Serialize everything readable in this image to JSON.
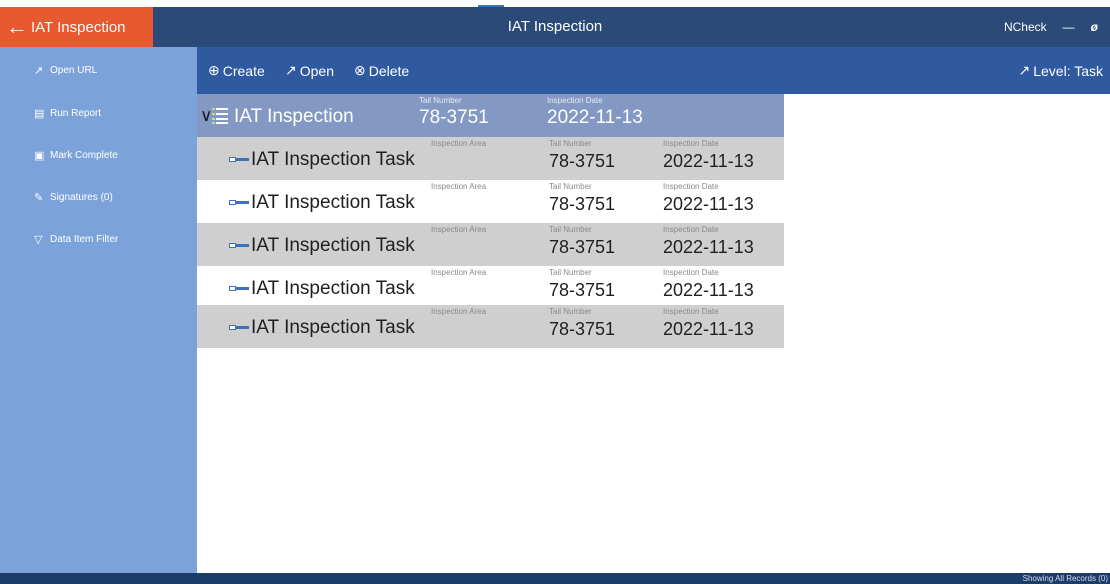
{
  "app": {
    "back_label": "IAT Inspection",
    "window_title": "IAT Inspection",
    "user": "NCheck",
    "minimize_glyph": "—",
    "restore_glyph": "ø"
  },
  "sidebar": {
    "items": [
      {
        "label": "Open URL",
        "icon": "external-link-icon"
      },
      {
        "label": "Run Report",
        "icon": "report-icon"
      },
      {
        "label": "Mark Complete",
        "icon": "lock-icon"
      },
      {
        "label": "Signatures (0)",
        "icon": "signature-icon"
      },
      {
        "label": "Data Item Filter",
        "icon": "filter-icon"
      }
    ]
  },
  "toolbar": {
    "create_label": "Create",
    "open_label": "Open",
    "delete_label": "Delete",
    "level_label": "Level: Task"
  },
  "tree": {
    "parent": {
      "name": "IAT Inspection",
      "tail_label": "Tail Number",
      "tail_value": "78-3751",
      "date_label": "Inspection Date",
      "date_value": "2022-11-13"
    },
    "tasks": [
      {
        "name": "IAT Inspection Task",
        "area_label": "Inspection Area",
        "tail_label": "Tail Number",
        "tail_value": "78-3751",
        "date_label": "Inspection Date",
        "date_value": "2022-11-13"
      },
      {
        "name": "IAT Inspection Task",
        "area_label": "Inspection Area",
        "tail_label": "Tail Number",
        "tail_value": "78-3751",
        "date_label": "Inspection Date",
        "date_value": "2022-11-13"
      },
      {
        "name": "IAT Inspection Task",
        "area_label": "Inspection Area",
        "tail_label": "Tail Number",
        "tail_value": "78-3751",
        "date_label": "Inspection Date",
        "date_value": "2022-11-13"
      },
      {
        "name": "IAT Inspection Task",
        "area_label": "Inspection Area",
        "tail_label": "Tail Number",
        "tail_value": "78-3751",
        "date_label": "Inspection Date",
        "date_value": "2022-11-13"
      },
      {
        "name": "IAT Inspection Task",
        "area_label": "Inspection Area",
        "tail_label": "Tail Number",
        "tail_value": "78-3751",
        "date_label": "Inspection Date",
        "date_value": "2022-11-13"
      }
    ]
  },
  "status": {
    "text": "Showing All Records (0)"
  },
  "colors": {
    "titlebar": "#2c4a78",
    "back_button": "#e8592f",
    "sidebar": "#7ba3d9",
    "toolbar": "#2f5a9f",
    "parent_row": "#8399c3",
    "grey_row": "#cfcfcf",
    "statusbar": "#1c3c6b"
  }
}
